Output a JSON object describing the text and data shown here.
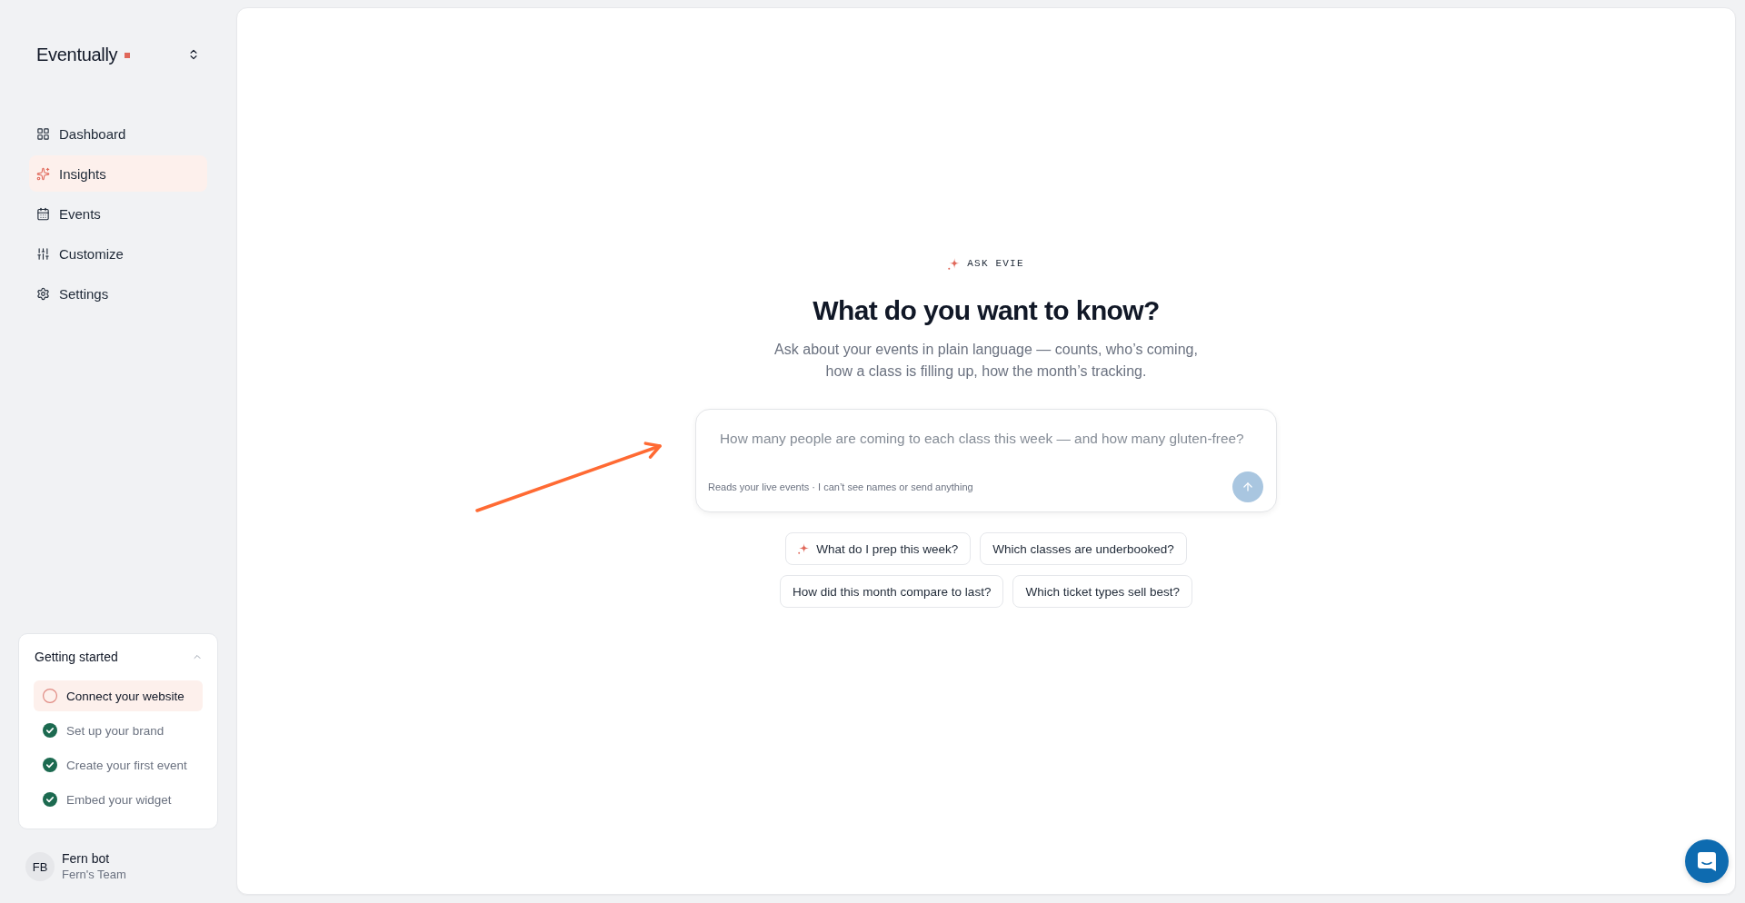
{
  "sidebar": {
    "brand": {
      "name": "Eventually"
    },
    "nav": [
      {
        "label": "Dashboard",
        "selected": false
      },
      {
        "label": "Insights",
        "selected": true
      },
      {
        "label": "Events",
        "selected": false
      },
      {
        "label": "Customize",
        "selected": false
      },
      {
        "label": "Settings",
        "selected": false
      }
    ]
  },
  "checklist": {
    "title": "Getting started",
    "expanded": true,
    "steps": [
      {
        "label": "Connect your website",
        "checked": false,
        "selected": true
      },
      {
        "label": "Set up your brand",
        "checked": true,
        "selected": false
      },
      {
        "label": "Create your first event",
        "checked": true,
        "selected": false
      },
      {
        "label": "Embed your widget",
        "checked": true,
        "selected": false
      }
    ]
  },
  "user": {
    "initials": "FB",
    "name": "Fern bot",
    "team": "Fern's Team"
  },
  "ask": {
    "eyebrow": "ASK EVIE",
    "heading": "What do you want to know?",
    "subtitle": "Ask about your events in plain language — counts, who’s coming, how a class is filling up, how the month’s tracking.",
    "prompt": {
      "placeholder": "How many people are coming to each class this week — and how many gluten-free?",
      "hint": "Reads your live events · I can’t see names or send anything",
      "send_disabled": true
    },
    "suggestions": [
      [
        {
          "kind": "featured",
          "label": "What do I prep this week?"
        },
        {
          "kind": "plain",
          "label": "Which classes are underbooked?"
        }
      ],
      [
        {
          "kind": "plain",
          "label": "How did this month compare to last?"
        },
        {
          "kind": "plain",
          "label": "Which ticket types sell best?"
        }
      ]
    ]
  }
}
